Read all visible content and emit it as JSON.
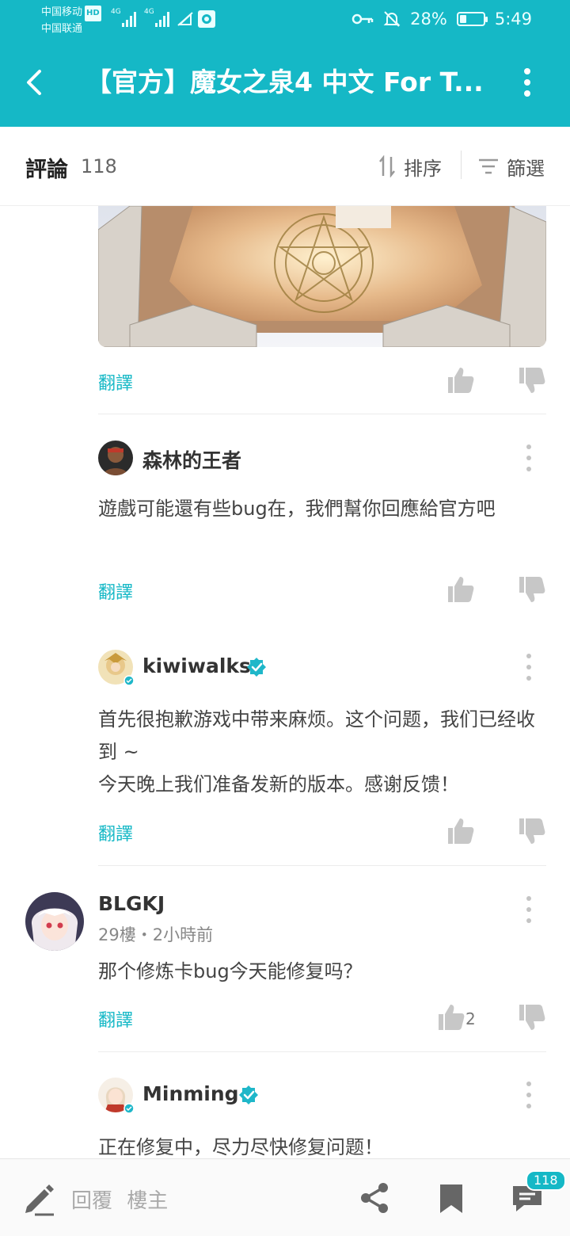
{
  "status_bar": {
    "carrier1": "中国移动",
    "carrier1_badge": "HD",
    "carrier2": "中国联通",
    "net1": "4G",
    "net2": "4G",
    "battery_percent": 28,
    "battery_text": "28%",
    "time": "5:49"
  },
  "appbar": {
    "title": "【官方】魔女之泉4 中文 For T..."
  },
  "comments_header": {
    "label": "評論",
    "count": "118",
    "sort_label": "排序",
    "filter_label": "篩選"
  },
  "thread": [
    {
      "translate_label": "翻譯"
    },
    {
      "author": "森林的王者",
      "text": "遊戲可能還有些bug在，我們幫你回應給官方吧",
      "translate_label": "翻譯"
    },
    {
      "author": "kiwiwalks",
      "verified": true,
      "text_line1": "首先很抱歉游戏中带来麻烦。这个问题，我们已经收到 ~",
      "text_line2": "今天晚上我们准备发新的版本。感谢反馈！",
      "translate_label": "翻譯"
    },
    {
      "author": "BLGKJ",
      "meta": "29樓・2小時前",
      "text": "那个修炼卡bug今天能修复吗？",
      "translate_label": "翻譯",
      "likes": "2"
    },
    {
      "author": "Minming",
      "verified": true,
      "text": "正在修复中，尽力尽快修复问题！"
    }
  ],
  "bottom_bar": {
    "reply_label": "回覆",
    "reply_target": "樓主",
    "comment_badge": "118"
  },
  "colors": {
    "accent": "#15b8c6",
    "verified": "#1fb7c9"
  }
}
